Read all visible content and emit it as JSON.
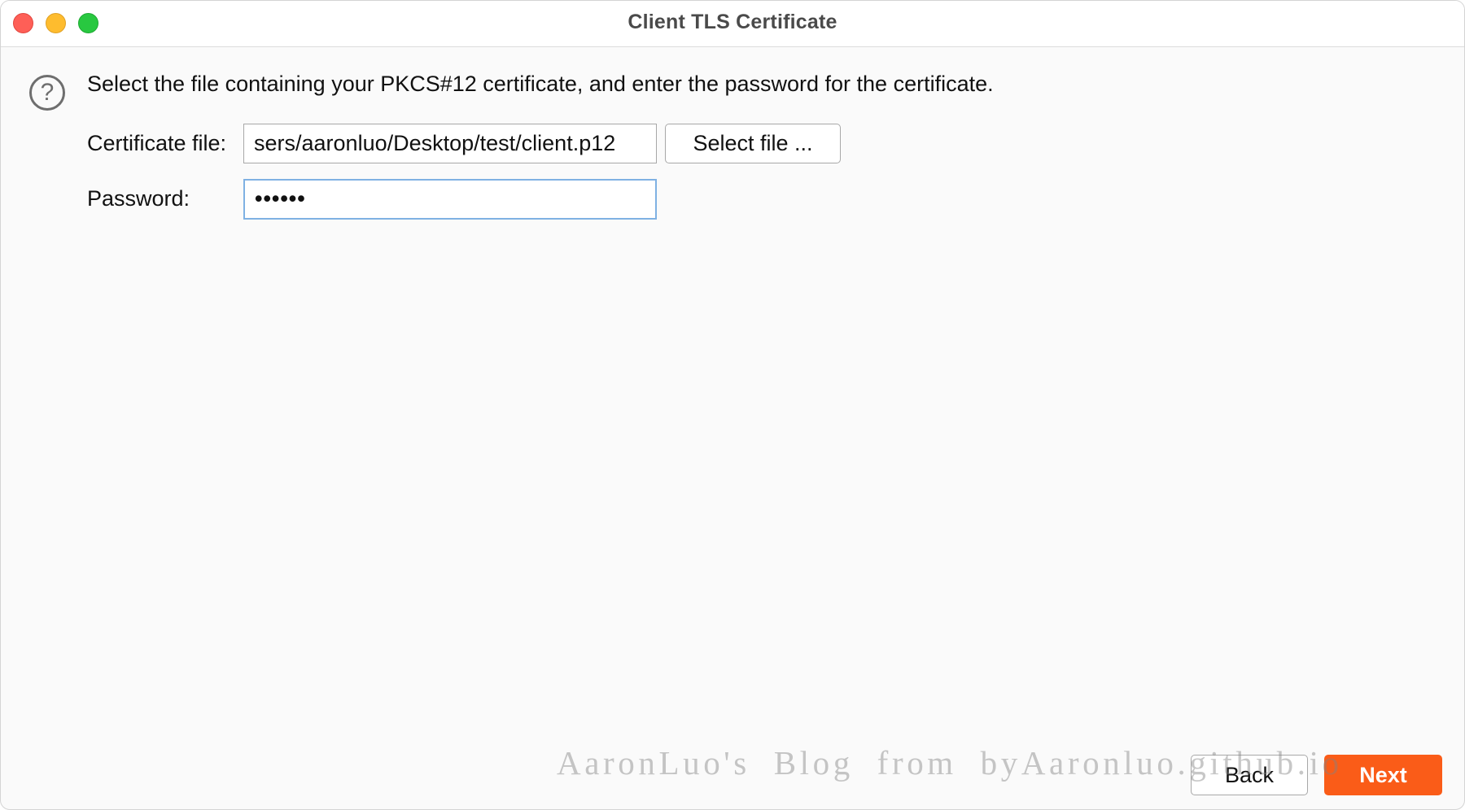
{
  "window": {
    "title": "Client TLS Certificate"
  },
  "icons": {
    "help": "question-mark-circle",
    "help_glyph": "?"
  },
  "dialog": {
    "instruction": "Select the file containing your PKCS#12 certificate, and enter the password for the certificate.",
    "certificate_label": "Certificate file:",
    "certificate_value": "sers/aaronluo/Desktop/test/client.p12",
    "select_file_label": "Select file ...",
    "password_label": "Password:",
    "password_masked": "••••••"
  },
  "footer": {
    "back_label": "Back",
    "next_label": "Next"
  },
  "watermark": "AaronLuo's Blog from byAaronluo.github.io",
  "colors": {
    "accent": "#fa5c18",
    "focus_ring": "#7fb1e3",
    "close": "#fe5f57",
    "minimize": "#febc2e",
    "zoom": "#28c840"
  }
}
